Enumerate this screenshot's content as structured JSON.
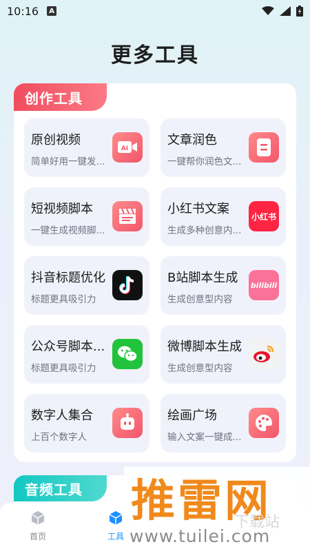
{
  "status_bar": {
    "time": "10:16",
    "notification_letter": "A"
  },
  "page": {
    "title": "更多工具"
  },
  "sections": [
    {
      "title": "创作工具",
      "color": "#f04d5e",
      "tools": [
        {
          "title": "原创视频",
          "subtitle": "简单好用一键发...",
          "icon": "ai-video-icon"
        },
        {
          "title": "文章润色",
          "subtitle": "一键帮你润色文...",
          "icon": "document-icon"
        },
        {
          "title": "短视频脚本",
          "subtitle": "一键生成视频脚...",
          "icon": "clapperboard-icon"
        },
        {
          "title": "小红书文案",
          "subtitle": "生成多种创意内...",
          "icon": "xiaohongshu-icon",
          "icon_text": "小红书"
        },
        {
          "title": "抖音标题优化",
          "subtitle": "标题更具吸引力",
          "icon": "douyin-icon"
        },
        {
          "title": "B站脚本生成",
          "subtitle": "生成创意型内容",
          "icon": "bilibili-icon",
          "icon_text": "bilibili"
        },
        {
          "title": "公众号脚本...",
          "subtitle": "标题更具吸引力",
          "icon": "wechat-icon"
        },
        {
          "title": "微博脚本生成",
          "subtitle": "生成创意型内容",
          "icon": "weibo-icon"
        },
        {
          "title": "数字人集合",
          "subtitle": "上百个数字人",
          "icon": "robot-icon"
        },
        {
          "title": "绘画广场",
          "subtitle": "输入文案一键成...",
          "icon": "palette-icon"
        }
      ]
    },
    {
      "title": "音频工具",
      "color": "#13c7c2"
    }
  ],
  "bottom_nav": {
    "items": [
      {
        "label": "首页",
        "icon": "home-cube-icon",
        "active": false
      },
      {
        "label": "工具",
        "icon": "tools-cube-icon",
        "active": true
      }
    ],
    "active_color": "#1e8fff",
    "inactive_color": "#888888"
  },
  "watermark": {
    "title": "推雷网",
    "url": "www.tuilei.com",
    "faint_text": "下载站"
  }
}
